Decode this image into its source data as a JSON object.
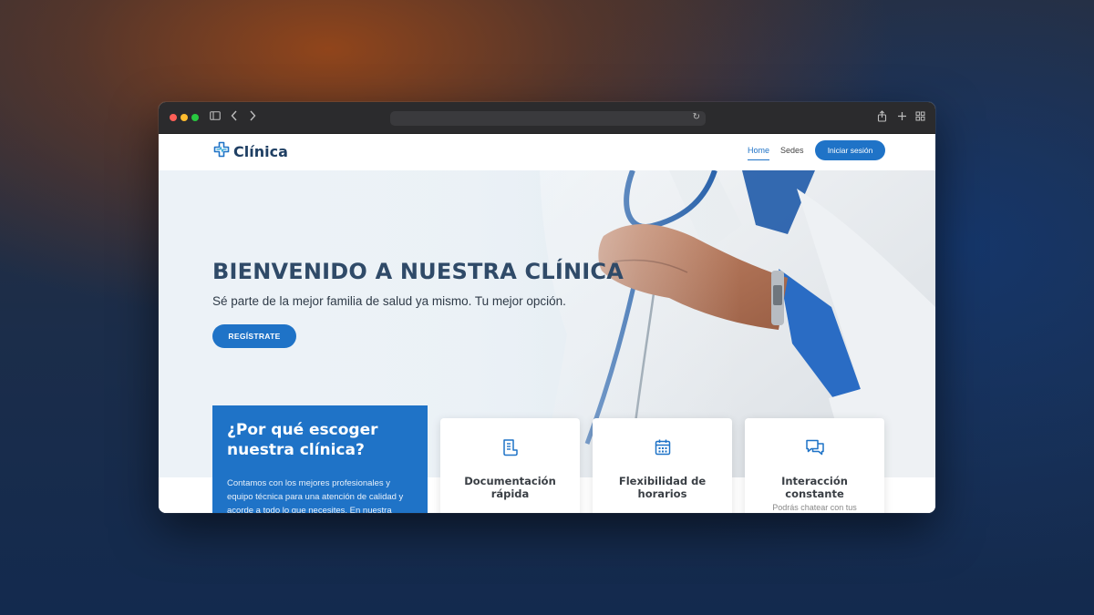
{
  "browser": {
    "url": "",
    "icons": [
      "sidebar-icon",
      "back-icon",
      "forward-icon",
      "reload-icon",
      "share-icon",
      "new-tab-icon",
      "tab-overview-icon"
    ]
  },
  "nav": {
    "logo_text": "Clínica",
    "links": [
      "Home",
      "Sedes"
    ],
    "active_link": "Home",
    "login_label": "Iniciar sesión",
    "accent_color": "#1f73c7"
  },
  "hero": {
    "title": "BIENVENIDO A NUESTRA CLÍNICA",
    "subtitle": "Sé parte de la mejor familia de salud ya mismo. Tu mejor opción.",
    "cta_label": "REGÍSTRATE"
  },
  "why": {
    "title": "¿Por qué escoger nuestra clínica?",
    "text": "Contamos con los mejores profesionales y equipo técnica para una atención de calidad y acorde a todo lo que necesites. En nuestra"
  },
  "features": [
    {
      "icon": "document-icon",
      "title": "Documentación rápida",
      "desc": ""
    },
    {
      "icon": "calendar-icon",
      "title": "Flexibilidad de horarios",
      "desc": ""
    },
    {
      "icon": "chat-icon",
      "title": "Interacción constante",
      "desc": "Podrás chatear con tus"
    }
  ]
}
